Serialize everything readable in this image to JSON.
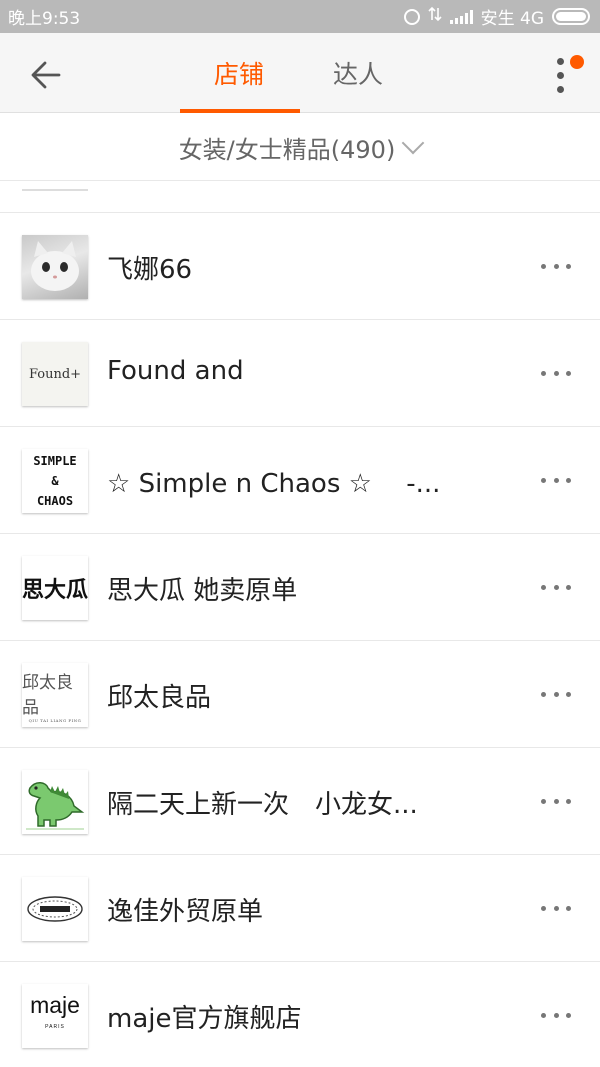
{
  "status_bar": {
    "time": "晚上9:53",
    "carrier": "安生 4G"
  },
  "nav": {
    "tabs": [
      {
        "label": "店铺",
        "active": true
      },
      {
        "label": "达人",
        "active": false
      }
    ],
    "accent_color": "#ff5a00",
    "badge_color": "#ff5a00"
  },
  "filter": {
    "label": "女装/女士精品(490)"
  },
  "stores": [
    {
      "name": "飞娜66",
      "logo_icon": "white-cat-photo"
    },
    {
      "name": "Found and",
      "logo_text": "Found+"
    },
    {
      "name": "☆ Simple n Chaos ☆　 -...",
      "logo_lines": [
        "SIMPLE",
        "&",
        "CHAOS"
      ]
    },
    {
      "name": "思大瓜  她卖原单",
      "logo_text": "思大瓜"
    },
    {
      "name": "邱太良品",
      "logo_text": "邱太良品",
      "logo_subtext": "QIU TAI LIANG PING"
    },
    {
      "name": "隔二天上新一次　小龙女...",
      "logo_icon": "green-dinosaur"
    },
    {
      "name": "逸佳外贸原单",
      "logo_icon": "laurel-wreath-emblem"
    },
    {
      "name": "maje官方旗舰店",
      "logo_text": "maje",
      "logo_subtext": "PARIS"
    }
  ]
}
